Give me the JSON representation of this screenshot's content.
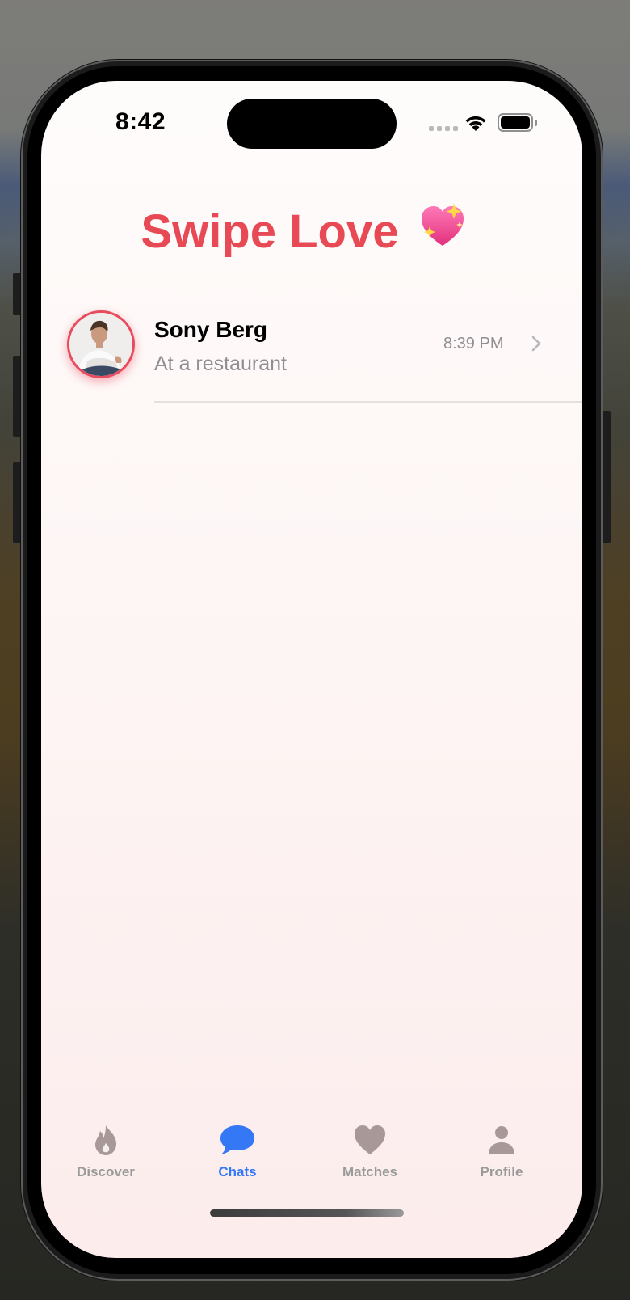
{
  "status_bar": {
    "time": "8:42"
  },
  "app": {
    "title": "Swipe Love",
    "title_emoji": "sparkling-heart-icon",
    "accent_color": "#e84a55"
  },
  "chats": [
    {
      "name": "Sony Berg",
      "last_message": "At a restaurant",
      "time": "8:39 PM",
      "avatar": "person-photo"
    }
  ],
  "tab_bar": {
    "active_color": "#3478f6",
    "inactive_color": "#9a9a9a",
    "tabs": [
      {
        "label": "Discover",
        "icon": "flame-icon",
        "active": false
      },
      {
        "label": "Chats",
        "icon": "chat-bubble-icon",
        "active": true
      },
      {
        "label": "Matches",
        "icon": "heart-icon",
        "active": false
      },
      {
        "label": "Profile",
        "icon": "person-icon",
        "active": false
      }
    ]
  }
}
